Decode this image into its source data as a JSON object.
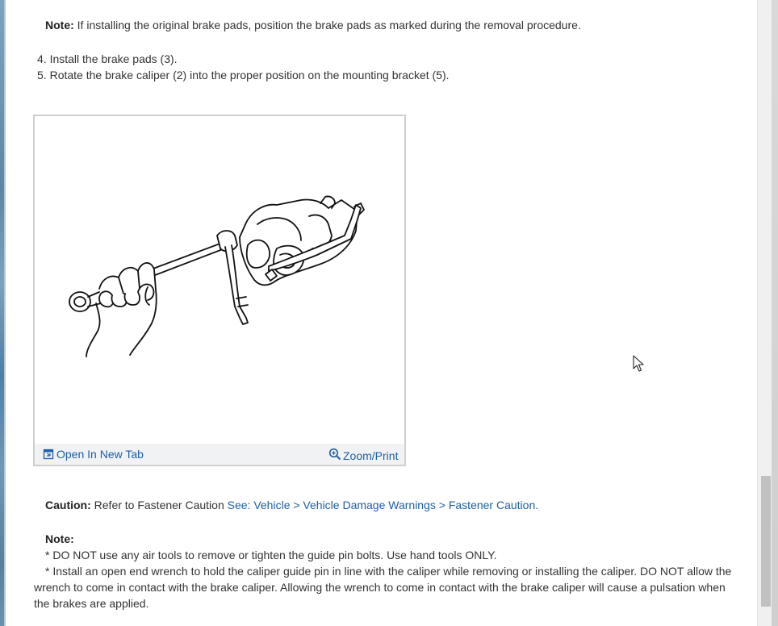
{
  "note_top": {
    "label": "Note:",
    "text": "If installing the original brake pads, position the brake pads as marked during the removal procedure."
  },
  "steps": [
    {
      "number": "4.",
      "text": "Install the brake pads (3)."
    },
    {
      "number": "5.",
      "text": "Rotate the brake caliper (2) into the proper position on the mounting bracket (5)."
    }
  ],
  "figure": {
    "open_tab_label": "Open In New Tab",
    "zoom_label": "Zoom/Print",
    "open_tab_icon": "open-new-tab-icon",
    "zoom_icon": "magnifier-zoom-icon"
  },
  "caution": {
    "label": "Caution:",
    "text": "Refer to Fastener Caution",
    "link_text": "See: Vehicle > Vehicle Damage Warnings > Fastener Caution",
    "link_suffix": "."
  },
  "note_bottom": {
    "label": "Note:",
    "bullets": [
      "*  DO NOT use any air tools to remove or tighten the guide pin bolts. Use hand tools ONLY.",
      "*  Install an open end wrench to hold the caliper guide pin in line with the caliper while removing or installing the caliper. DO NOT allow the wrench to come in contact with the brake caliper. Allowing the wrench to come in contact with the brake caliper will cause a pulsation when the brakes are applied."
    ]
  },
  "colors": {
    "link": "#1d5fa8",
    "text": "#333333",
    "figure_bar": "#f1f2f4"
  }
}
